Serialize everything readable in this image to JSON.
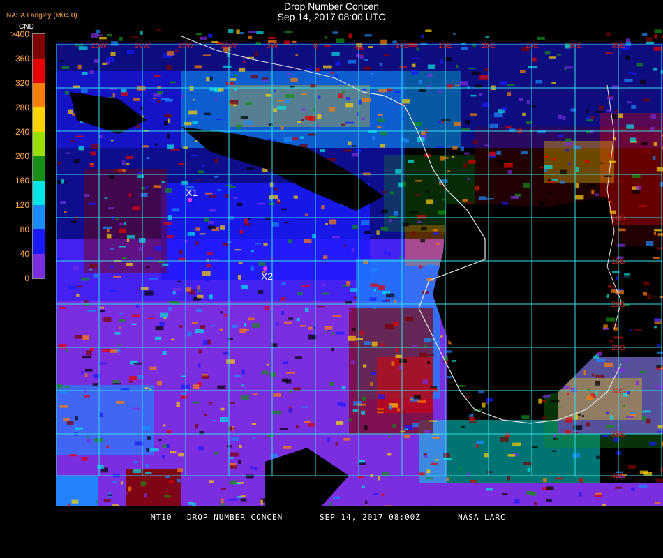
{
  "header": {
    "title": "Drop Number Concen",
    "subtitle": "Sep 14, 2017 08:00 UTC",
    "producer": "NASA Langley (M04.0)"
  },
  "legend": {
    "title": "CND",
    "labels": [
      ">400",
      "360",
      "320",
      "280",
      "240",
      "200",
      "160",
      "120",
      "80",
      "40",
      "0"
    ],
    "colors": [
      "#7f0000",
      "#e60000",
      "#ff7f00",
      "#ffd200",
      "#9adf00",
      "#168f16",
      "#00e5e5",
      "#1a8cff",
      "#1a1aff",
      "#7a2ee0"
    ]
  },
  "map": {
    "top_labels": [
      "25W",
      "20W",
      "15W",
      "10W",
      "5W",
      "0",
      "5E",
      "10E",
      "15E",
      "20E",
      "25E",
      "30E",
      "35E"
    ],
    "right_labels": [
      "10S",
      "15S",
      "20S",
      "25S",
      "30S",
      "35S",
      "40S"
    ],
    "markers": [
      {
        "label": "X1"
      },
      {
        "label": "X2"
      }
    ],
    "grid_color": "#33e0e8",
    "label_color": "#cc1f1f"
  },
  "footer": {
    "product": "MT10",
    "parameter": "DROP NUMBER CONCEN",
    "date": "SEP 14, 2017 08:00Z",
    "source": "NASA LARC"
  }
}
